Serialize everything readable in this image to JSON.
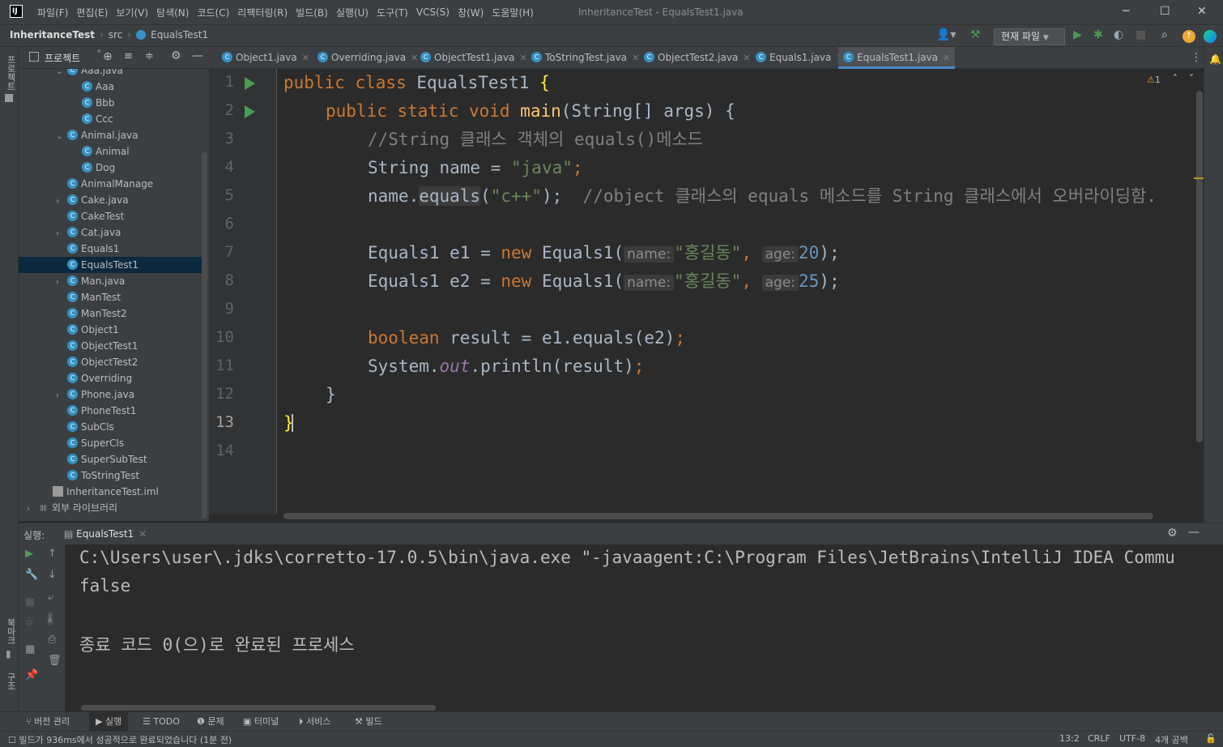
{
  "titlebar": {
    "menu": [
      "파일(F)",
      "편집(E)",
      "보기(V)",
      "탐색(N)",
      "코드(C)",
      "리팩터링(R)",
      "빌드(B)",
      "실행(U)",
      "도구(T)",
      "VCS(S)",
      "창(W)",
      "도움말(H)"
    ],
    "window_title": "InheritanceTest - EqualsTest1.java"
  },
  "navbar": {
    "project": "InheritanceTest",
    "folder": "src",
    "file": "EqualsTest1",
    "run_config": "현재 파일"
  },
  "left_stripe": {
    "project_label": "프로젝트",
    "bookmarks_label": "북마크",
    "structure_label": "구조"
  },
  "project_panel": {
    "title": "프로젝트",
    "tree": [
      {
        "label": "Aaa.java",
        "indent": 2,
        "arrow": "v"
      },
      {
        "label": "Aaa",
        "indent": 3,
        "arrow": ""
      },
      {
        "label": "Bbb",
        "indent": 3,
        "arrow": ""
      },
      {
        "label": "Ccc",
        "indent": 3,
        "arrow": ""
      },
      {
        "label": "Animal.java",
        "indent": 2,
        "arrow": "v"
      },
      {
        "label": "Animal",
        "indent": 3,
        "arrow": ""
      },
      {
        "label": "Dog",
        "indent": 3,
        "arrow": ""
      },
      {
        "label": "AnimalManage",
        "indent": 2,
        "arrow": ""
      },
      {
        "label": "Cake.java",
        "indent": 2,
        "arrow": ">"
      },
      {
        "label": "CakeTest",
        "indent": 2,
        "arrow": ""
      },
      {
        "label": "Cat.java",
        "indent": 2,
        "arrow": ">"
      },
      {
        "label": "Equals1",
        "indent": 2,
        "arrow": ""
      },
      {
        "label": "EqualsTest1",
        "indent": 2,
        "arrow": "",
        "selected": true
      },
      {
        "label": "Man.java",
        "indent": 2,
        "arrow": ">"
      },
      {
        "label": "ManTest",
        "indent": 2,
        "arrow": ""
      },
      {
        "label": "ManTest2",
        "indent": 2,
        "arrow": ""
      },
      {
        "label": "Object1",
        "indent": 2,
        "arrow": ""
      },
      {
        "label": "ObjectTest1",
        "indent": 2,
        "arrow": ""
      },
      {
        "label": "ObjectTest2",
        "indent": 2,
        "arrow": ""
      },
      {
        "label": "Overriding",
        "indent": 2,
        "arrow": ""
      },
      {
        "label": "Phone.java",
        "indent": 2,
        "arrow": ">"
      },
      {
        "label": "PhoneTest1",
        "indent": 2,
        "arrow": ""
      },
      {
        "label": "SubCls",
        "indent": 2,
        "arrow": ""
      },
      {
        "label": "SuperCls",
        "indent": 2,
        "arrow": ""
      },
      {
        "label": "SuperSubTest",
        "indent": 2,
        "arrow": ""
      },
      {
        "label": "ToStringTest",
        "indent": 2,
        "arrow": ""
      },
      {
        "label": "InheritanceTest.iml",
        "indent": 1,
        "arrow": "",
        "iml": true
      },
      {
        "label": "외부 라이브러리",
        "indent": 0,
        "arrow": ">",
        "lib": true
      }
    ]
  },
  "tabs": [
    {
      "label": "Object1.java"
    },
    {
      "label": "Overriding.java"
    },
    {
      "label": "ObjectTest1.java"
    },
    {
      "label": "ToStringTest.java"
    },
    {
      "label": "ObjectTest2.java"
    },
    {
      "label": "Equals1.java"
    },
    {
      "label": "EqualsTest1.java",
      "active": true
    }
  ],
  "editor": {
    "warnings_count": "1",
    "line_numbers": [
      "1",
      "2",
      "3",
      "4",
      "5",
      "6",
      "7",
      "8",
      "9",
      "10",
      "11",
      "12",
      "13",
      "14"
    ],
    "current_line": 13,
    "code": {
      "l1_kw": "public class ",
      "l1_name": "EqualsTest1 ",
      "l1_brace": "{",
      "l2_kw": "public static void ",
      "l2_fn": "main",
      "l2_rest": "(String[] args) {",
      "l3": "//String 클래스 객체의 equals()메소드",
      "l4_a": "String name = ",
      "l4_str": "\"java\"",
      "l4_semi": ";",
      "l5_a": "name.",
      "l5_method": "equals",
      "l5_b": "(",
      "l5_str": "\"c++\"",
      "l5_c": ");",
      "l5_comment": "//object 클래스의 equals 메소드를 String 클래스에서 오버라이딩함.",
      "l7_a": "Equals1 e1 = ",
      "l8_a": "Equals1 e2 = ",
      "new_kw": "new ",
      "ctor": "Equals1(",
      "hint_name": "name:",
      "hint_age": "age:",
      "l7_str": "\"홍길동\"",
      "l8_str": "\"홍길동\"",
      "comma": ",",
      "l7_num": "20",
      "l8_num": "25",
      "close": ");",
      "l10_kw": "boolean ",
      "l10_rest": "result = e1.equals(e2)",
      "semi": ";",
      "l11_a": "System.",
      "l11_out": "out",
      "l11_b": ".println(result)",
      "l12": "}",
      "l13": "}"
    }
  },
  "run_panel": {
    "label": "실행:",
    "tab": "EqualsTest1",
    "console": [
      "C:\\Users\\user\\.jdks\\corretto-17.0.5\\bin\\java.exe \"-javaagent:C:\\Program Files\\JetBrains\\IntelliJ IDEA Commu",
      "false",
      "",
      "종료 코드 0(으)로 완료된 프로세스"
    ]
  },
  "bottom_tabs": [
    "버전 관리",
    "실행",
    "TODO",
    "문제",
    "터미널",
    "서비스",
    "빌드"
  ],
  "status": {
    "message": "빌드가 936ms에서 성공적으로 완료되었습니다 (1분 전)",
    "position": "13:2",
    "line_sep": "CRLF",
    "encoding": "UTF-8",
    "indent": "4개 공백"
  }
}
